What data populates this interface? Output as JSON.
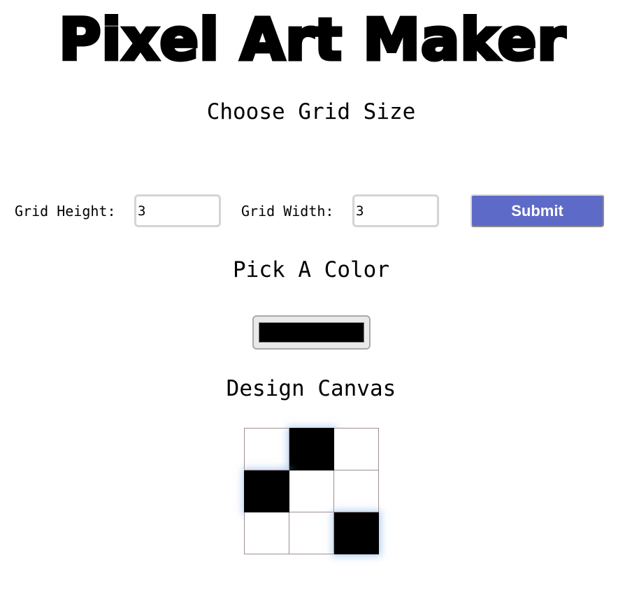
{
  "header": {
    "title": "Pixel Art Maker"
  },
  "grid_size": {
    "heading": "Choose Grid Size",
    "height_label": "Grid Height:",
    "height_value": "3",
    "width_label": "Grid Width:",
    "width_value": "3",
    "submit_label": "Submit"
  },
  "color_section": {
    "heading": "Pick A Color",
    "selected_color": "#000000"
  },
  "canvas_section": {
    "heading": "Design Canvas",
    "rows": 3,
    "cols": 3,
    "cells": [
      [
        "#ffffff",
        "#000000",
        "#ffffff"
      ],
      [
        "#000000",
        "#ffffff",
        "#ffffff"
      ],
      [
        "#ffffff",
        "#ffffff",
        "#000000"
      ]
    ]
  },
  "colors": {
    "submit_bg": "#5e6ac7",
    "submit_text": "#ffffff",
    "cell_border": "#9e8f93"
  }
}
